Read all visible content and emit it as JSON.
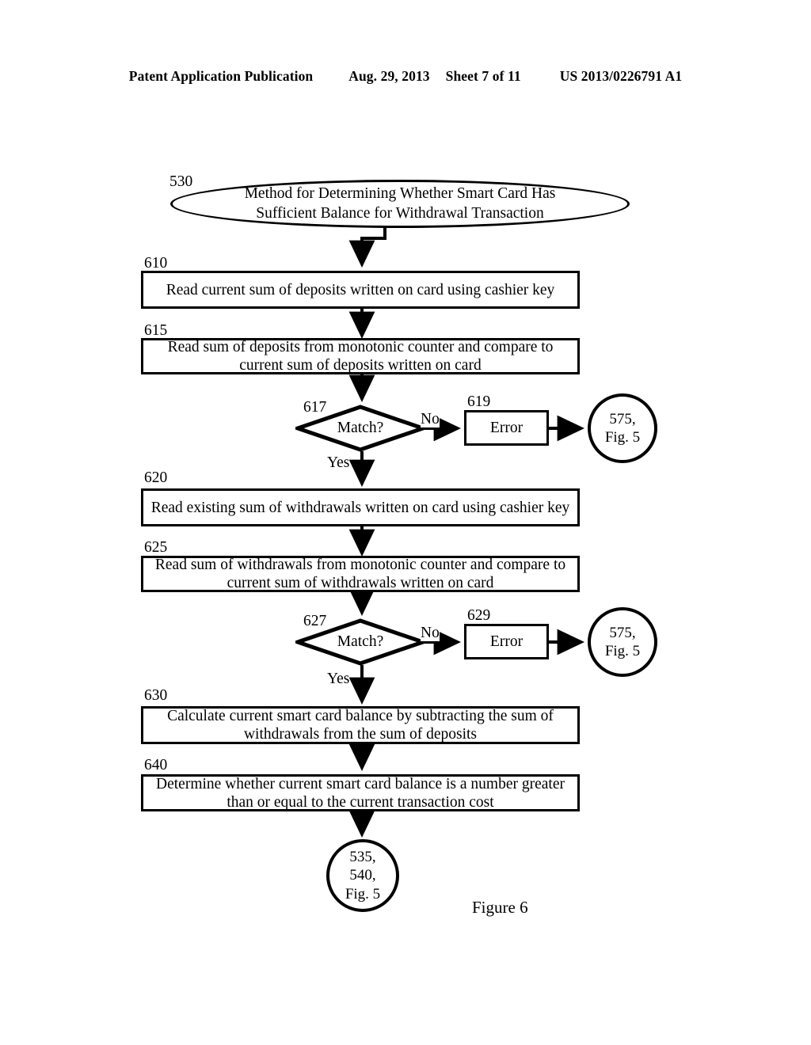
{
  "header": {
    "publication": "Patent Application Publication",
    "date": "Aug. 29, 2013",
    "sheet": "Sheet 7 of 11",
    "patent_number": "US 2013/0226791 A1"
  },
  "figure": {
    "caption": "Figure 6"
  },
  "flowchart": {
    "start": {
      "ref": "530",
      "line1": "Method for Determining Whether Smart Card Has",
      "line2": "Sufficient Balance for Withdrawal Transaction"
    },
    "steps": [
      {
        "ref": "610",
        "line1": "Read current sum of deposits written on card using cashier key",
        "line2": ""
      },
      {
        "ref": "615",
        "line1": "Read sum of deposits from monotonic counter and compare to",
        "line2": "current sum of deposits written on card"
      },
      {
        "ref": "620",
        "line1": "Read existing sum of withdrawals written on card using cashier key",
        "line2": ""
      },
      {
        "ref": "625",
        "line1": "Read sum of withdrawals from monotonic counter and compare to",
        "line2": "current sum of withdrawals written on card"
      },
      {
        "ref": "630",
        "line1": "Calculate current smart card balance by subtracting the sum of",
        "line2": "withdrawals from the sum of deposits"
      },
      {
        "ref": "640",
        "line1": "Determine whether current smart card balance is a number greater",
        "line2": "than or equal to the current transaction cost"
      }
    ],
    "decisions": [
      {
        "ref": "617",
        "label": "Match?",
        "yes": "Yes",
        "no": "No"
      },
      {
        "ref": "627",
        "label": "Match?",
        "yes": "Yes",
        "no": "No"
      }
    ],
    "errors": [
      {
        "ref": "619",
        "label": "Error"
      },
      {
        "ref": "629",
        "label": "Error"
      }
    ],
    "connectors": [
      {
        "line1": "575,",
        "line2": "Fig. 5"
      },
      {
        "line1": "575,",
        "line2": "Fig. 5"
      }
    ],
    "terminal": {
      "line1": "535,",
      "line2": "540,",
      "line3": "Fig. 5"
    }
  },
  "colors": {
    "ink": "#000000",
    "paper": "#ffffff"
  }
}
